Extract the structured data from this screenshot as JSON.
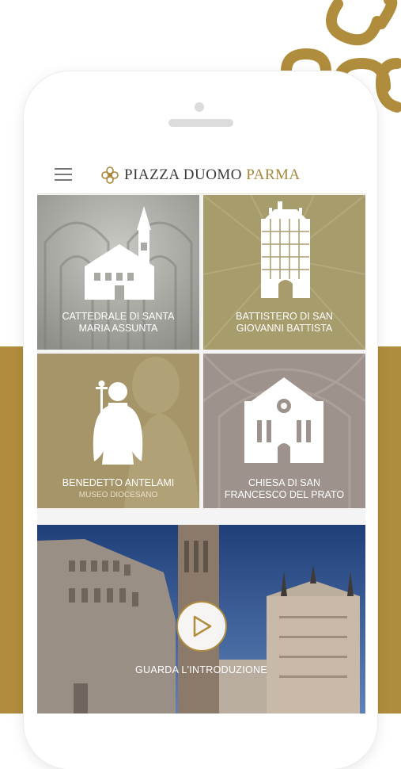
{
  "app": {
    "title_main": "PIAZZA DUOMO",
    "title_accent": "PARMA"
  },
  "tiles": [
    {
      "label_line1": "CATTEDRALE DI SANTA",
      "label_line2": "MARIA ASSUNTA"
    },
    {
      "label_line1": "BATTISTERO DI SAN",
      "label_line2": "GIOVANNI BATTISTA"
    },
    {
      "label_line1": "BENEDETTO ANTELAMI",
      "sublabel": "MUSEO DIOCESANO"
    },
    {
      "label_line1": "CHIESA DI SAN",
      "label_line2": "FRANCESCO DEL PRATO"
    }
  ],
  "intro": {
    "label": "GUARDA L'INTRODUZIONE"
  },
  "colors": {
    "gold": "#b08d3c",
    "tile_gray": "#a9a9a4",
    "tile_olive": "#a79c6c",
    "tile_khaki": "#a69568",
    "tile_taupe": "#9d938c"
  }
}
